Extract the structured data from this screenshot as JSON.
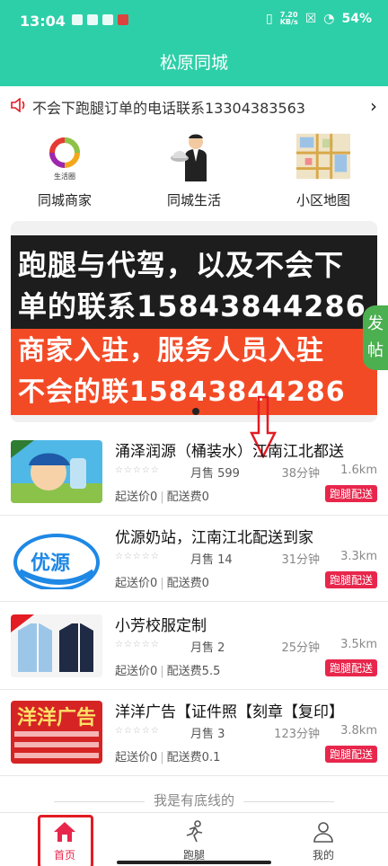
{
  "statusbar": {
    "time": "13:04",
    "net_speed_top": "7.20",
    "net_speed_bottom": "KB/s",
    "battery": "54%"
  },
  "app_title": "松原同城",
  "notice": {
    "text": "不会下跑腿订单的电话联系13304383563"
  },
  "quicknav": [
    {
      "label": "同城商家",
      "icon": "shop-circle-icon",
      "sub": "生活圈"
    },
    {
      "label": "同城生活",
      "icon": "waiter-icon"
    },
    {
      "label": "小区地图",
      "icon": "map-icon"
    }
  ],
  "banner": {
    "line1": "跑腿与代驾，以及不会下",
    "line2": "单的联系15843844286",
    "line3": "商家入驻，服务人员入驻",
    "line4": "不会的联15843844286"
  },
  "fab_label": "发帖",
  "shops": [
    {
      "name": "涌泽润源（桶装水）江南江北都送",
      "sales": "月售 599",
      "time": "38分钟",
      "distance": "1.6km",
      "min_order": "起送价0",
      "delivery_fee": "配送费0",
      "tag": "跑腿配送",
      "stars": "☆☆☆☆☆"
    },
    {
      "name": "优源奶站，江南江北配送到家",
      "sales": "月售 14",
      "time": "31分钟",
      "distance": "3.3km",
      "min_order": "起送价0",
      "delivery_fee": "配送费0",
      "tag": "跑腿配送",
      "stars": "☆☆☆☆☆"
    },
    {
      "name": "小芳校服定制",
      "sales": "月售 2",
      "time": "25分钟",
      "distance": "3.5km",
      "min_order": "起送价0",
      "delivery_fee": "配送费5.5",
      "tag": "跑腿配送",
      "stars": "☆☆☆☆☆"
    },
    {
      "name": "洋洋广告【证件照【刻章【复印】",
      "sales": "月售 3",
      "time": "123分钟",
      "distance": "3.8km",
      "min_order": "起送价0",
      "delivery_fee": "配送费0.1",
      "tag": "跑腿配送",
      "stars": "☆☆☆☆☆"
    }
  ],
  "thumb_texts": {
    "shop2_logo": "优源",
    "shop4_logo": "洋洋广告"
  },
  "footer_note": "我是有底线的",
  "tabs": [
    {
      "label": "首页",
      "icon": "home-icon",
      "active": true
    },
    {
      "label": "跑腿",
      "icon": "runner-icon",
      "active": false
    },
    {
      "label": "我的",
      "icon": "user-icon",
      "active": false
    }
  ],
  "colors": {
    "brand": "#2dcfa8",
    "tag_red": "#e8264c",
    "fab_green": "#4caf50"
  }
}
